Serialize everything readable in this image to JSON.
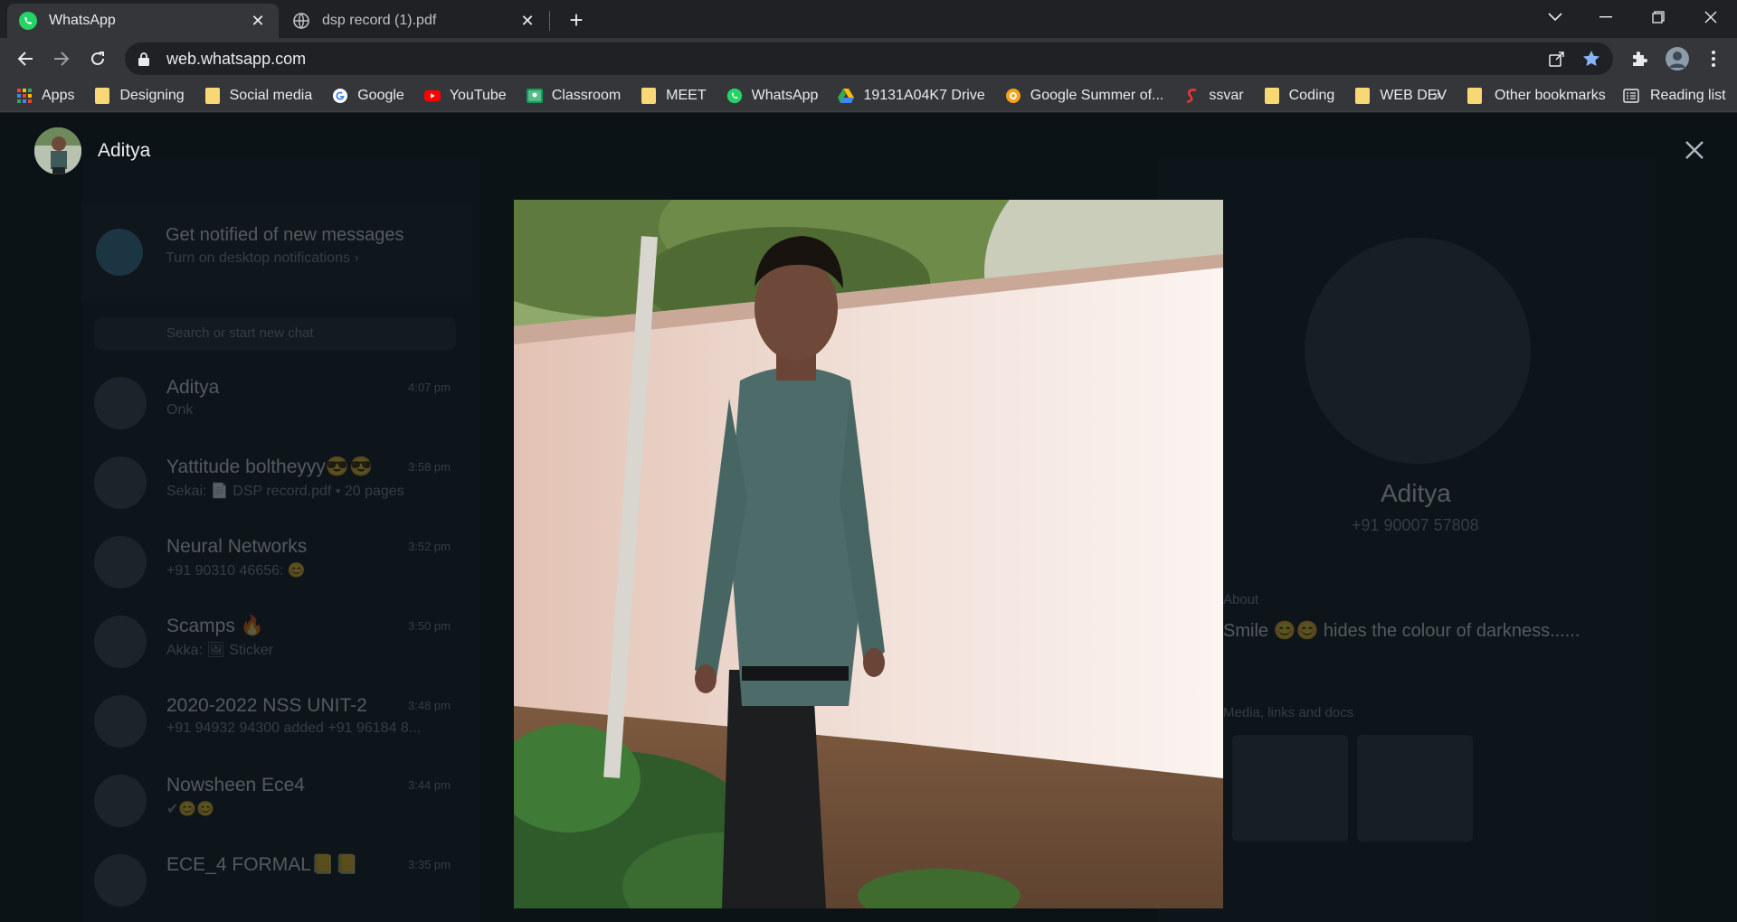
{
  "browser": {
    "tabs": [
      {
        "title": "WhatsApp",
        "icon": "whatsapp-icon",
        "active": true
      },
      {
        "title": "dsp record (1).pdf",
        "icon": "globe-icon",
        "active": false
      }
    ],
    "url": "web.whatsapp.com",
    "bookmarks": [
      {
        "label": "Apps",
        "icon": "apps-grid-icon"
      },
      {
        "label": "Designing",
        "icon": "folder-icon"
      },
      {
        "label": "Social media",
        "icon": "folder-icon"
      },
      {
        "label": "Google",
        "icon": "google-icon"
      },
      {
        "label": "YouTube",
        "icon": "youtube-icon"
      },
      {
        "label": "Classroom",
        "icon": "classroom-icon"
      },
      {
        "label": "MEET",
        "icon": "folder-icon"
      },
      {
        "label": "WhatsApp",
        "icon": "whatsapp-icon"
      },
      {
        "label": "19131A04K7 Drive",
        "icon": "drive-icon"
      },
      {
        "label": "Google Summer of...",
        "icon": "gsoc-icon"
      },
      {
        "label": "ssvar",
        "icon": "ssvar-icon"
      },
      {
        "label": "Coding",
        "icon": "folder-icon"
      },
      {
        "label": "WEB DEV",
        "icon": "folder-icon"
      }
    ],
    "bookmarks_overflow": "»",
    "other_bookmarks": "Other bookmarks",
    "reading_list": "Reading list"
  },
  "viewer": {
    "contact_name": "Aditya"
  },
  "background": {
    "notification_title": "Get notified of new messages",
    "notification_sub": "Turn on desktop notifications ›",
    "search_placeholder": "Search or start new chat",
    "chats": [
      {
        "name": "Aditya",
        "message": "Onk",
        "time": "4:07 pm"
      },
      {
        "name": "Yattitude boltheyyy😎😎",
        "message": "Sekai: 📄 DSP record.pdf • 20 pages",
        "time": "3:58 pm"
      },
      {
        "name": "Neural Networks",
        "message": "+91 90310 46656: 😊",
        "time": "3:52 pm"
      },
      {
        "name": "Scamps 🔥",
        "message": "Akka: 🖼 Sticker",
        "time": "3:50 pm"
      },
      {
        "name": "2020-2022 NSS UNIT-2",
        "message": "+91 94932 94300 added +91 96184 8...",
        "time": "3:48 pm"
      },
      {
        "name": "Nowsheen Ece4",
        "message": "✔😊😊",
        "time": "3:44 pm"
      },
      {
        "name": "ECE_4 FORMAL📒📒",
        "message": "",
        "time": "3:35 pm"
      }
    ],
    "profile_name": "Aditya",
    "profile_phone": "+91 90007 57808",
    "about_label": "About",
    "about_text": "Smile 😊😊 hides the colour of darkness......",
    "media_label": "Media, links and docs"
  },
  "colors": {
    "chrome_dark": "#202124",
    "chrome_toolbar": "#35363a",
    "whatsapp_bg": "#0c1317",
    "bookmark_star": "#8ab4f8",
    "whatsapp_green": "#25d366"
  }
}
